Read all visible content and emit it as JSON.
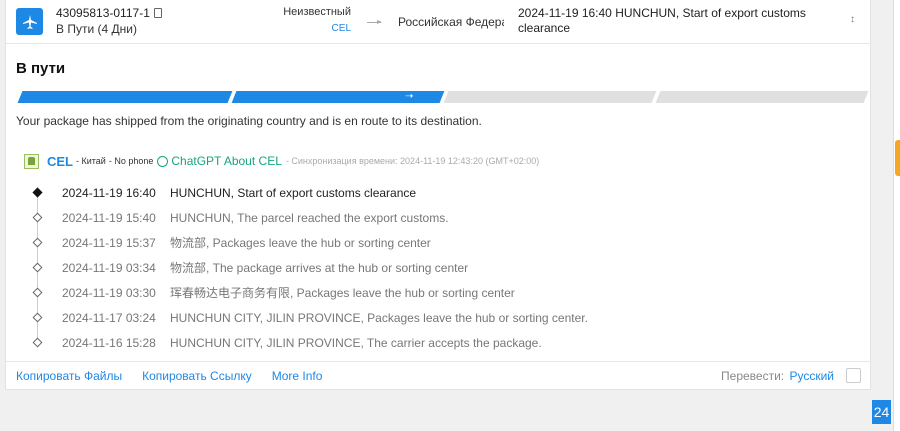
{
  "header": {
    "tracking_number": "43095813-0117-1",
    "status": "В Пути (4 Дни)",
    "origin": "Неизвестный",
    "origin_carrier": "CEL",
    "destination": "Российская Федерация",
    "last_event": "2024-11-19 16:40  HUNCHUN, Start of export customs clearance"
  },
  "main": {
    "title": "В пути",
    "progress_stage": 3,
    "progress_total": 5,
    "description": "Your package has shipped from the originating country and is en route to its destination."
  },
  "carrier": {
    "name": "CEL",
    "country": "- Китай",
    "phone": "- No phone",
    "gpt_link": "ChatGPT About CEL",
    "sync": "- Синхронизация времени: 2024-11-19 12:43:20 (GMT+02:00)"
  },
  "events": [
    {
      "time": "2024-11-19 16:40",
      "text": "HUNCHUN, Start of export customs clearance"
    },
    {
      "time": "2024-11-19 15:40",
      "text": "HUNCHUN, The parcel reached the export customs."
    },
    {
      "time": "2024-11-19 15:37",
      "text": "物流部, Packages leave the hub or sorting center"
    },
    {
      "time": "2024-11-19 03:34",
      "text": "物流部, The package arrives at the hub or sorting center"
    },
    {
      "time": "2024-11-19 03:30",
      "text": "珲春畅达电子商务有限, Packages leave the hub or sorting center"
    },
    {
      "time": "2024-11-17 03:24",
      "text": "HUNCHUN CITY, JILIN PROVINCE, Packages leave the hub or sorting center."
    },
    {
      "time": "2024-11-16 15:28",
      "text": "HUNCHUN CITY, JILIN PROVINCE, The carrier accepts the package."
    }
  ],
  "footer": {
    "copy_files": "Копировать Файлы",
    "copy_link": "Копировать Ссылку",
    "more_info": "More Info",
    "translate_label": "Перевести:",
    "translate_lang": "Русский"
  },
  "badge": "24",
  "colors": {
    "accent": "#1e88e5",
    "gpt": "#19a37f",
    "idle": "#e0e0e0"
  }
}
